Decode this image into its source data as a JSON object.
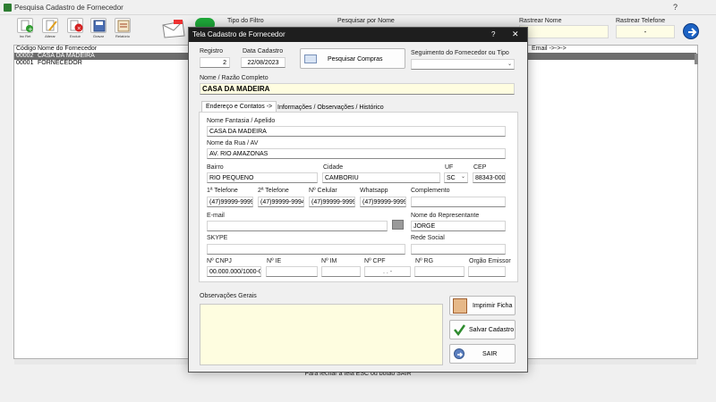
{
  "background_window": {
    "title": "Pesquisa Cadastro de Fornecedor",
    "help": "?",
    "toolbar": [
      {
        "label": "Inc Ret"
      },
      {
        "label": "Alterar"
      },
      {
        "label": "Excluir"
      },
      {
        "label": "Gravar"
      },
      {
        "label": "Relatório"
      }
    ],
    "filter": {
      "tipo_label": "Tipo do Filtro",
      "search_label": "Pesquisar por Nome",
      "rastrear_nome_label": "Rastrear Nome",
      "rastrear_telefone_label": "Rastrear Telefone",
      "rastrear_telefone_value": "-"
    },
    "list": {
      "headers": [
        "Código",
        "Nome do Fornecedor",
        "Email ->->->"
      ],
      "rows": [
        {
          "code": "00002",
          "name": "CASA DA MADEIRA"
        },
        {
          "code": "00001",
          "name": "FORNECEDOR"
        }
      ]
    },
    "status_text": "Para fechar a tela ESC ou botão SAIR"
  },
  "dialog": {
    "title": "Tela Cadastro de Fornecedor",
    "help": "?",
    "close": "✕",
    "registro_label": "Registro",
    "registro_value": "2",
    "data_label": "Data Cadastro",
    "data_value": "22/08/2023",
    "pesquisar_compras": "Pesquisar Compras",
    "segmento_label": "Seguimento do Fornecedor ou Tipo",
    "segmento_value": "",
    "nome_label": "Nome / Razão Completo",
    "nome_value": "CASA DA MADEIRA",
    "tabs": [
      {
        "label": "Endereço e Contatos ->"
      },
      {
        "label": "Informações / Observações / Histórico"
      }
    ],
    "fields": {
      "fantasia_label": "Nome Fantasia / Apelido",
      "fantasia_value": "CASA DA MADEIRA",
      "rua_label": "Nome da Rua / AV",
      "rua_value": "AV. RIO AMAZONAS",
      "bairro_label": "Bairro",
      "bairro_value": "RIO PEQUENO",
      "cidade_label": "Cidade",
      "cidade_value": "CAMBORIU",
      "uf_label": "UF",
      "uf_value": "SC",
      "cep_label": "CEP",
      "cep_value": "88343-000",
      "tel1_label": "1ª Telefone",
      "tel1_value": "(47)99999-9999",
      "tel2_label": "2ª Telefone",
      "tel2_value": "(47)99999-9994",
      "cel_label": "Nº Celular",
      "cel_value": "(47)99999-9999",
      "whatsapp_label": "Whatsapp",
      "whatsapp_value": "(47)99999-9999",
      "complemento_label": "Complemento",
      "complemento_value": "",
      "email_label": "E-mail",
      "email_value": "",
      "representante_label": "Nome do Representante",
      "representante_value": "JORGE",
      "skype_label": "SKYPE",
      "skype_value": "",
      "rede_label": "Rede Social",
      "rede_value": "",
      "cnpj_label": "Nº CNPJ",
      "cnpj_value": "00.000.000/1000-0",
      "ie_label": "Nº IE",
      "ie_value": "",
      "im_label": "Nº IM",
      "im_value": "",
      "cpf_label": "Nº CPF",
      "cpf_value": ". . -",
      "rg_label": "Nº RG",
      "rg_value": "",
      "orgao_label": "Orgão Emissor",
      "orgao_value": ""
    },
    "obs_label": "Observações Gerais",
    "buttons": {
      "imprimir": "Imprimir Ficha",
      "salvar": "Salvar Cadastro",
      "sair": "SAIR"
    }
  },
  "colors": {
    "dialog_titlebar": "#1e1e1e",
    "list_selected": "#6d6d6d",
    "name_field_bg": "#fffde0"
  }
}
